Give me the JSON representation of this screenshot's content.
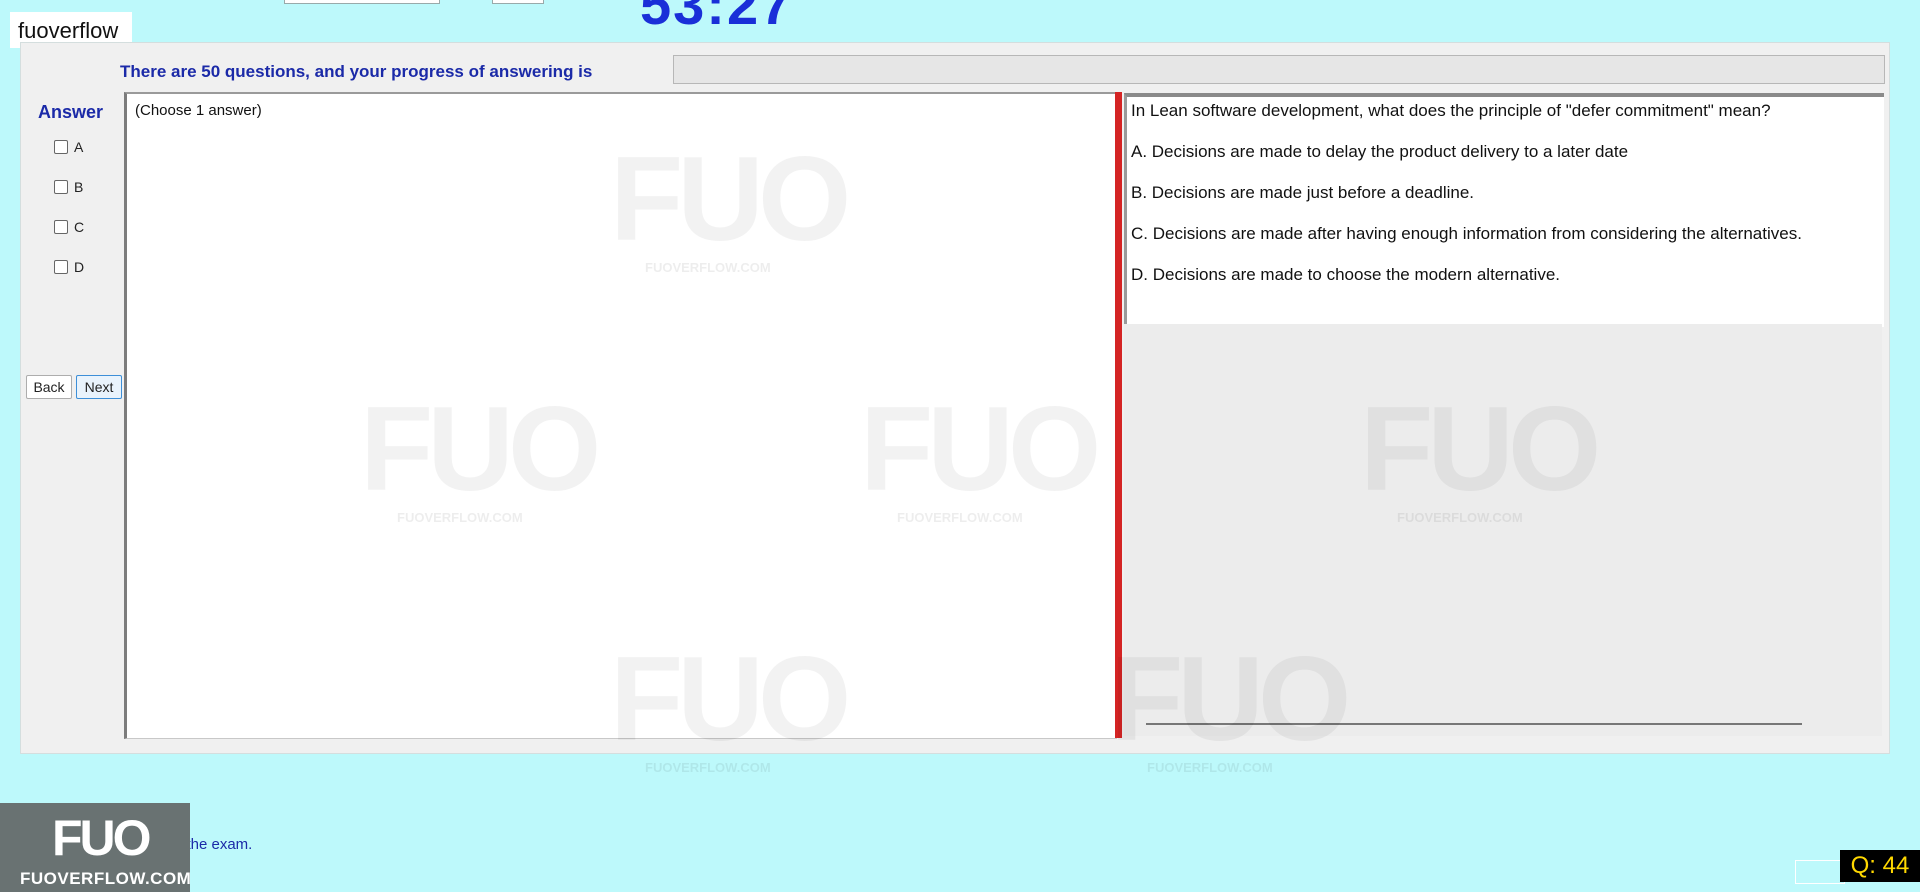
{
  "brand": {
    "name": "fuoverflow"
  },
  "timer": {
    "text": "53:27"
  },
  "progress": {
    "label": "There are 50 questions, and your progress of answering is",
    "value": 0
  },
  "answer_panel": {
    "title": "Answer",
    "options": [
      {
        "letter": "A",
        "checked": false
      },
      {
        "letter": "B",
        "checked": false
      },
      {
        "letter": "C",
        "checked": false
      },
      {
        "letter": "D",
        "checked": false
      }
    ],
    "choose_note": "(Choose 1 answer)"
  },
  "nav": {
    "back_label": "Back",
    "next_label": "Next"
  },
  "question": {
    "text": "In Lean software development, what does the principle of \"defer commitment\" mean?",
    "choices": [
      "A.  Decisions are made to delay the product delivery to a later date",
      "B.  Decisions are made just before a deadline.",
      "C.  Decisions are made after having enough information from considering the alternatives.",
      "D.  Decisions are made to choose the modern alternative."
    ]
  },
  "watermark": {
    "big": "FUO",
    "small": "FUOVERFLOW.COM"
  },
  "footer": {
    "finish_text": "Want to finish the exam.",
    "logo_big": "FUO",
    "logo_small": "FUOVERFLOW.COM",
    "question_badge": "Q: 44"
  },
  "colors": {
    "background": "#bdf9fb",
    "accent": "#1b2aa8",
    "divider": "#d42424",
    "timer": "#1a2fd8"
  }
}
